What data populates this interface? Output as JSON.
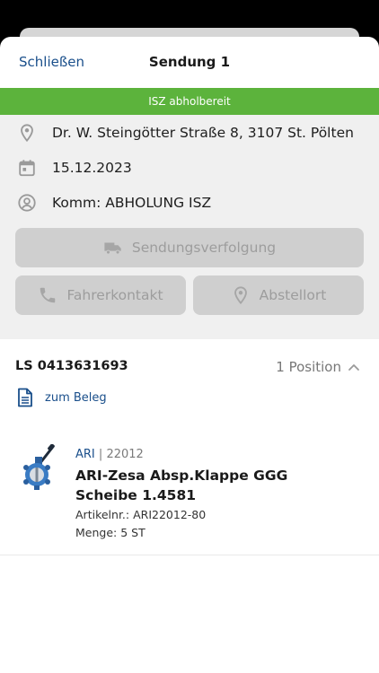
{
  "nav": {
    "close_label": "Schließen",
    "title": "Sendung 1"
  },
  "status": {
    "label": "ISZ abholbereit",
    "color": "#5cb33c"
  },
  "info": {
    "address": "Dr. W. Steingötter Straße 8, 3107 St. Pölten",
    "date": "15.12.2023",
    "commission": "Komm: ABHOLUNG ISZ"
  },
  "actions": {
    "tracking_label": "Sendungsverfolgung",
    "driver_label": "Fahrerkontakt",
    "dropoff_label": "Abstellort"
  },
  "delivery": {
    "ls_number": "LS 0413631693",
    "positions": "1 Position",
    "beleg_label": "zum Beleg"
  },
  "item": {
    "brand": "ARI",
    "separator": "|",
    "code": "22012",
    "name": "ARI-Zesa Absp.Klappe GGG Scheibe 1.4581",
    "article_no": "Artikelnr.: ARI22012-80",
    "quantity": "Menge: 5 ST"
  },
  "icons": {
    "address": "location-pin-icon",
    "date": "calendar-icon",
    "commission": "user-circle-icon",
    "tracking": "truck-icon",
    "driver": "phone-icon",
    "dropoff": "location-pin-icon",
    "beleg": "document-icon",
    "collapse": "chevron-up-icon"
  }
}
